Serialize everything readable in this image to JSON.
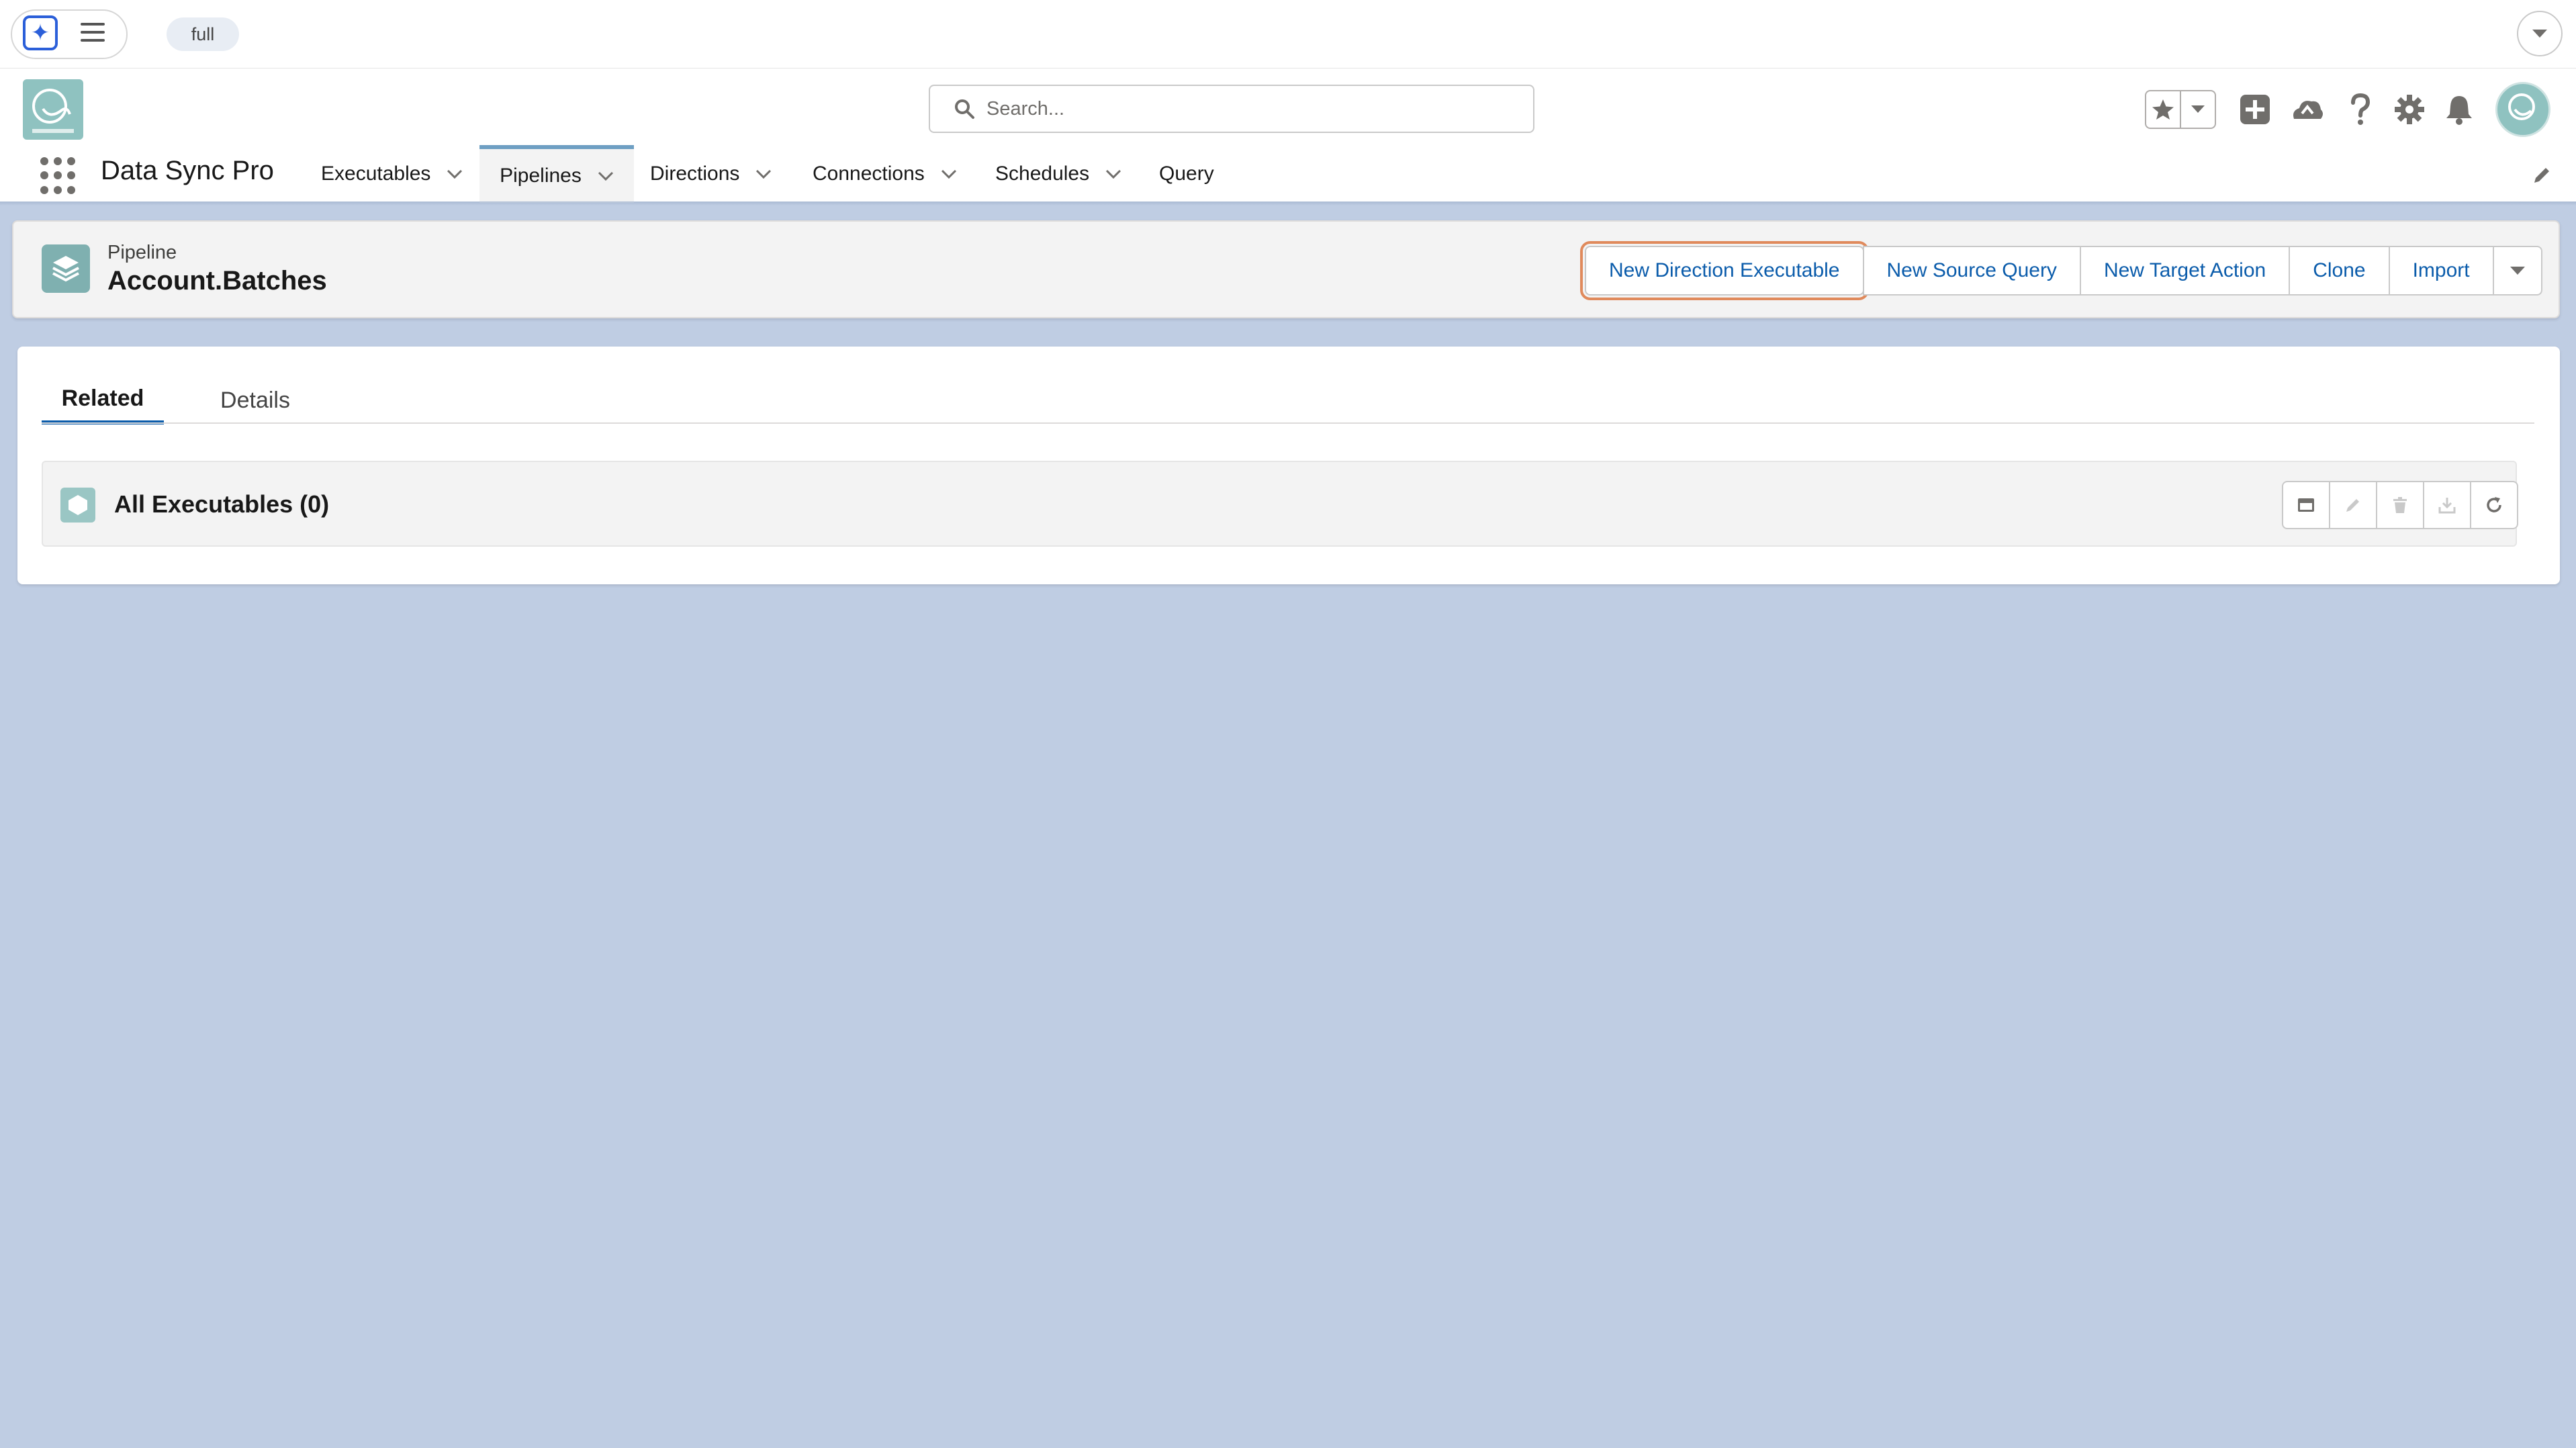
{
  "utility_bar": {
    "environment_label": "full"
  },
  "header": {
    "search": {
      "placeholder": "Search..."
    }
  },
  "nav": {
    "app_name": "Data Sync Pro",
    "items": [
      {
        "label": "Executables",
        "has_menu": true
      },
      {
        "label": "Pipelines",
        "has_menu": true,
        "active": true
      },
      {
        "label": "Directions",
        "has_menu": true
      },
      {
        "label": "Connections",
        "has_menu": true
      },
      {
        "label": "Schedules",
        "has_menu": true
      },
      {
        "label": "Query",
        "has_menu": false
      }
    ]
  },
  "record": {
    "object_type": "Pipeline",
    "name": "Account.Batches",
    "actions": {
      "new_direction_executable": "New Direction Executable",
      "new_source_query": "New Source Query",
      "new_target_action": "New Target Action",
      "clone": "Clone",
      "import": "Import"
    }
  },
  "tabs": {
    "related": "Related",
    "details": "Details",
    "active": "Related"
  },
  "related_list": {
    "title": "All Executables (0)"
  },
  "icons": {
    "utility": [
      "sparkle-icon",
      "menu-icon",
      "chevron-down-icon"
    ],
    "header": [
      "search-icon",
      "star-icon",
      "chevron-down-icon",
      "add-icon",
      "cloud-icon",
      "help-icon",
      "gear-icon",
      "bell-icon"
    ],
    "related_actions": [
      "view-icon",
      "edit-icon",
      "delete-icon",
      "download-icon",
      "refresh-icon"
    ]
  },
  "colors": {
    "brand": "#0b5cab",
    "background": "#bfcde3",
    "highlight_outline": "#e08a5c",
    "record_icon": "#7fb0b0"
  }
}
